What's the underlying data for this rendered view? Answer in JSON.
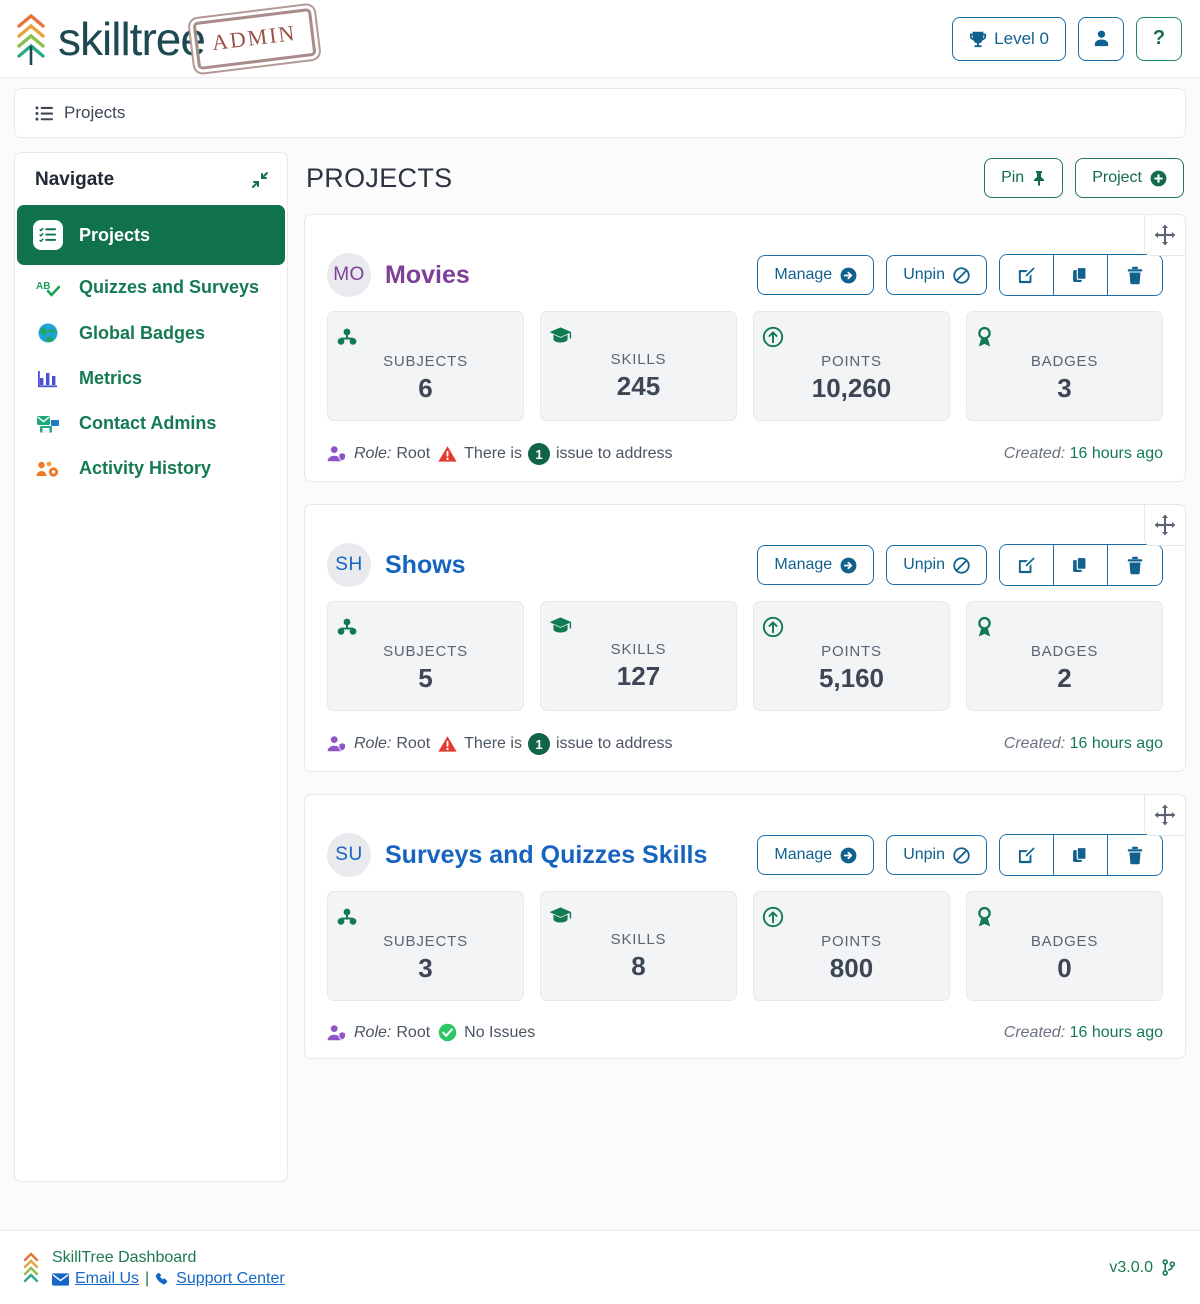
{
  "header": {
    "brand_name": "skilltree",
    "admin_badge": "ADMIN",
    "level_label": "Level 0",
    "help_label": "?"
  },
  "breadcrumb": {
    "label": "Projects"
  },
  "sidebar": {
    "title": "Navigate",
    "items": [
      {
        "label": "Projects",
        "icon": "list-check-icon",
        "active": true
      },
      {
        "label": "Quizzes and Surveys",
        "icon": "spell-check-icon",
        "active": false
      },
      {
        "label": "Global Badges",
        "icon": "globe-icon",
        "active": false
      },
      {
        "label": "Metrics",
        "icon": "chart-bar-icon",
        "active": false
      },
      {
        "label": "Contact Admins",
        "icon": "mail-bulk-icon",
        "active": false
      },
      {
        "label": "Activity History",
        "icon": "users-cog-icon",
        "active": false
      }
    ]
  },
  "main": {
    "title": "PROJECTS",
    "pin_label": "Pin",
    "new_project_label": "Project"
  },
  "card_actions": {
    "manage_label": "Manage",
    "unpin_label": "Unpin",
    "edit_icon": "edit-icon",
    "copy_icon": "copy-icon",
    "delete_icon": "trash-icon",
    "drag_icon": "move-handle-icon"
  },
  "stat_labels": {
    "subjects": "SUBJECTS",
    "skills": "SKILLS",
    "points": "POINTS",
    "badges": "BADGES"
  },
  "footer_labels": {
    "role_prefix": "Role:",
    "created_prefix": "Created:"
  },
  "projects": [
    {
      "initials": "MO",
      "name": "Movies",
      "color": "#7e3f98",
      "subjects": "6",
      "skills": "245",
      "points": "10,260",
      "badges": "3",
      "role": "Root",
      "issue_prefix": "There is",
      "issue_count": "1",
      "issue_suffix": "issue to address",
      "has_issues": true,
      "created": "16 hours ago"
    },
    {
      "initials": "SH",
      "name": "Shows",
      "color": "#1664c0",
      "subjects": "5",
      "skills": "127",
      "points": "5,160",
      "badges": "2",
      "role": "Root",
      "issue_prefix": "There is",
      "issue_count": "1",
      "issue_suffix": "issue to address",
      "has_issues": true,
      "created": "16 hours ago"
    },
    {
      "initials": "SU",
      "name": "Surveys and Quizzes Skills",
      "color": "#1664c0",
      "subjects": "3",
      "skills": "8",
      "points": "800",
      "badges": "0",
      "role": "Root",
      "no_issues_label": "No Issues",
      "has_issues": false,
      "created": "16 hours ago"
    }
  ],
  "footer": {
    "app_name": "SkillTree Dashboard",
    "email_link": "Email Us",
    "separator": "|",
    "support_link": "Support Center",
    "version": "v3.0.0"
  }
}
